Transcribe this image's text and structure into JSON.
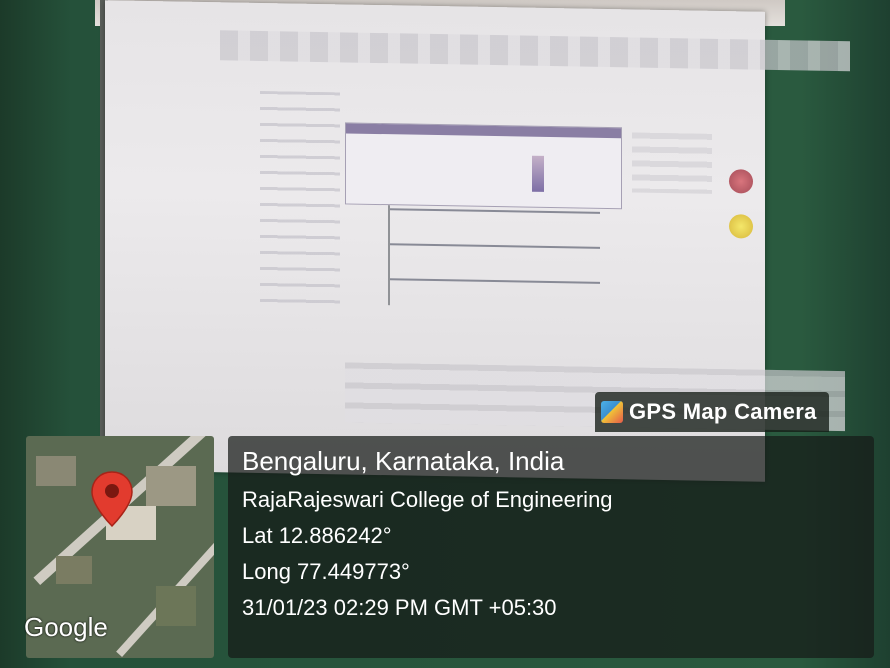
{
  "brand": {
    "name": "GPS Map Camera",
    "icon": "gps-map-camera-logo"
  },
  "location": {
    "title": "Bengaluru, Karnataka, India",
    "place": "RajaRajeswari College of Engineering",
    "lat": "Lat 12.886242°",
    "long": "Long 77.449773°",
    "datetime": "31/01/23 02:29 PM GMT +05:30"
  },
  "map": {
    "attribution": "Google",
    "marker_icon": "map-pin-icon",
    "marker_color": "#e23b2e"
  },
  "projected_ui": {
    "lamp_colors": [
      "#c8606c",
      "#ecd84e"
    ]
  }
}
